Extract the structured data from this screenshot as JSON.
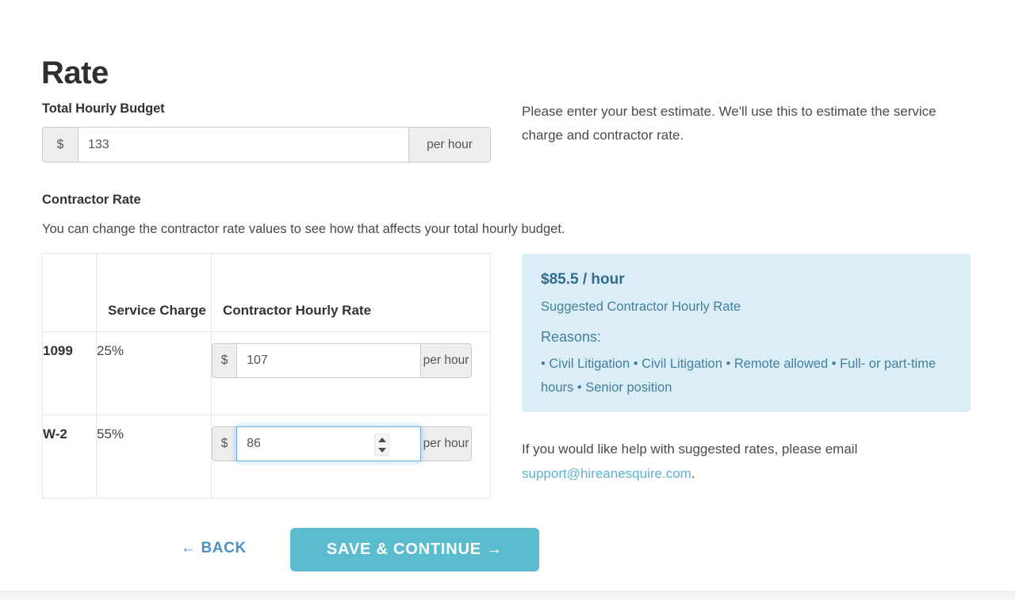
{
  "page": {
    "title": "Rate"
  },
  "total_budget": {
    "label": "Total Hourly Budget",
    "currency_symbol": "$",
    "value": "133",
    "suffix": "per hour",
    "helper_text": "Please enter your best estimate. We'll use this to estimate the service charge and contractor rate."
  },
  "contractor": {
    "label": "Contractor Rate",
    "description": "You can change the contractor rate values to see how that affects your total hourly budget.",
    "table": {
      "headers": [
        "",
        "Service Charge",
        "Contractor Hourly Rate"
      ],
      "rows": [
        {
          "type": "1099",
          "service_charge": "25%",
          "currency_symbol": "$",
          "rate": "107",
          "suffix": "per hour",
          "focused": false
        },
        {
          "type": "W-2",
          "service_charge": "55%",
          "currency_symbol": "$",
          "rate": "86",
          "suffix": "per hour",
          "focused": true
        }
      ]
    }
  },
  "info_panel": {
    "amount": "$85.5 / hour",
    "subtitle": "Suggested Contractor Hourly Rate",
    "reasons_title": "Reasons:",
    "reasons_text": "• Civil Litigation • Civil Litigation • Remote allowed • Full- or part-time hours • Senior position",
    "background_color": "#dbeef7",
    "text_color": "#447e9b"
  },
  "support": {
    "text_before": "If you would like help with suggested rates, please email ",
    "email": "support@hireanesquire.com",
    "text_after": ".",
    "link_color": "#5bb3d4"
  },
  "actions": {
    "back_label": "← BACK",
    "back_color": "#4a90c4",
    "save_label": "SAVE & CONTINUE →",
    "save_color": "#5bbcd0"
  }
}
